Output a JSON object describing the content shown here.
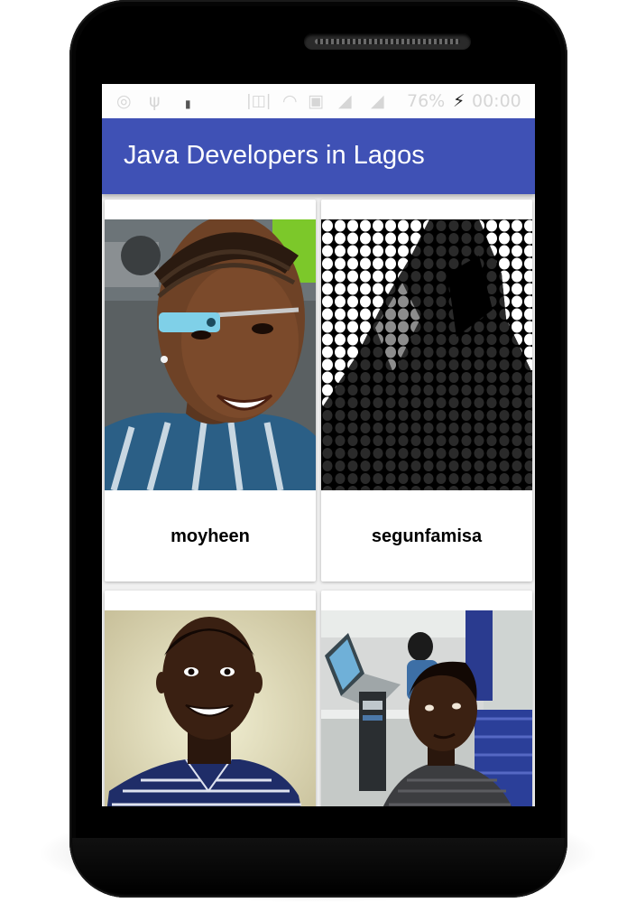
{
  "status_bar": {
    "battery": "76%",
    "time": "00:00",
    "icons": [
      "whatsapp-icon",
      "usb-icon",
      "notification-icon",
      "vibrate-icon",
      "wifi-icon",
      "sim-icon",
      "signal-icon",
      "signal-icon",
      "charging-icon"
    ]
  },
  "app_bar": {
    "title": "Java Developers in Lagos"
  },
  "developers": [
    {
      "username": "moyheen",
      "photo": "woman-with-glass-photo"
    },
    {
      "username": "segunfamisa",
      "photo": "halftone-dot-portrait-photo"
    },
    {
      "username": "",
      "photo": "smiling-man-striped-shirt-photo"
    },
    {
      "username": "",
      "photo": "man-at-office-desk-photo"
    }
  ],
  "colors": {
    "primary": "#3F51B5",
    "card": "#FFFFFF",
    "background": "#F0F0F0"
  }
}
